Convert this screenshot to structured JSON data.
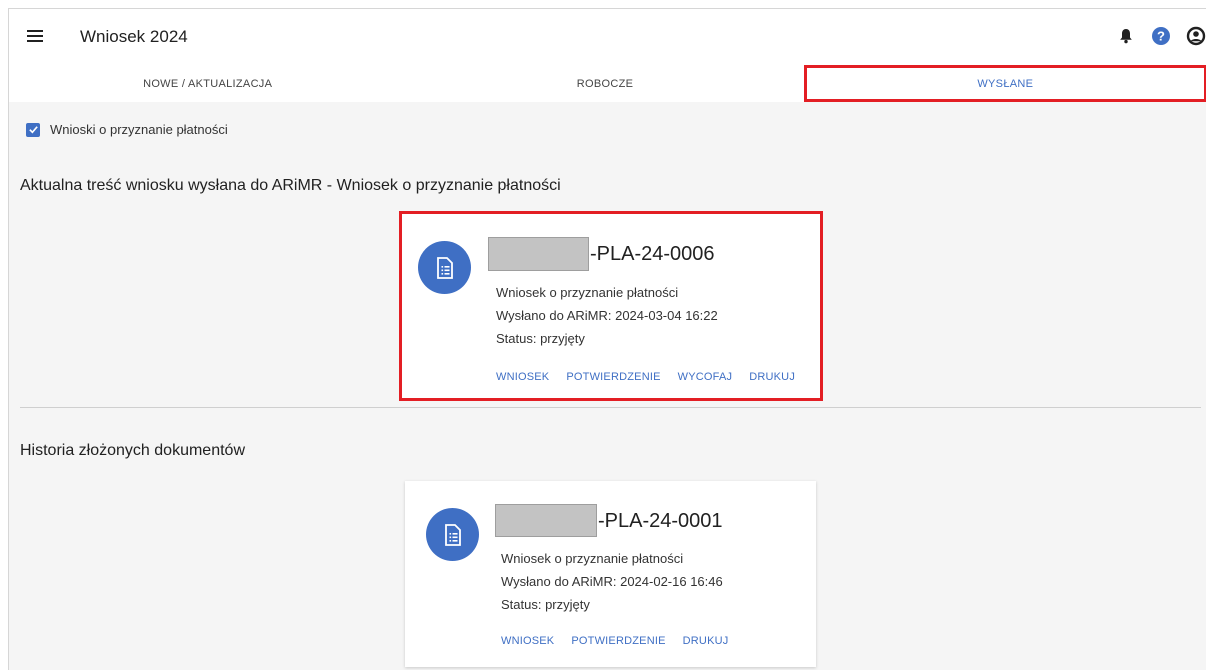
{
  "header": {
    "title": "Wniosek 2024",
    "icons": [
      "menu-icon",
      "bell-icon",
      "help-icon",
      "account-icon"
    ]
  },
  "tabs": [
    {
      "label": "NOWE / AKTUALIZACJA",
      "active": false
    },
    {
      "label": "ROBOCZE",
      "active": false
    },
    {
      "label": "WYSŁANE",
      "active": true
    }
  ],
  "filter": {
    "label": "Wnioski o przyznanie płatności",
    "checked": true
  },
  "current": {
    "section_title": "Aktualna treść wniosku wysłana do ARiMR - Wniosek o przyznanie płatności",
    "card": {
      "number_suffix": "-PLA-24-0006",
      "type": "Wniosek o przyznanie płatności",
      "sent": "Wysłano do ARiMR: 2024-03-04 16:22",
      "status": "Status: przyjęty",
      "actions": [
        "WNIOSEK",
        "POTWIERDZENIE",
        "WYCOFAJ",
        "DRUKUJ"
      ]
    }
  },
  "history": {
    "section_title": "Historia złożonych dokumentów",
    "card": {
      "number_suffix": "-PLA-24-0001",
      "type": "Wniosek o przyznanie płatności",
      "sent": "Wysłano do ARiMR: 2024-02-16 16:46",
      "status": "Status: przyjęty",
      "actions": [
        "WNIOSEK",
        "POTWIERDZENIE",
        "DRUKUJ"
      ]
    }
  },
  "colors": {
    "accent": "#3f6fc4",
    "highlight": "#e31e24",
    "background": "#f5f5f5"
  }
}
